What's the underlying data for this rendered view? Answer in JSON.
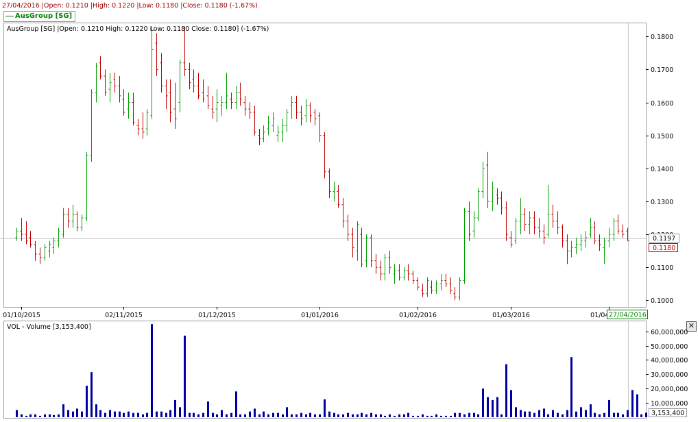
{
  "header": {
    "info_line": "27/04/2016 |Open: 0.1210 |High: 0.1220 |Low: 0.1180 |Close: 0.1180 (-1.67%)"
  },
  "legend": {
    "label": "AusGroup [SG]"
  },
  "price_panel": {
    "title": "AusGroup [SG] |Open: 0.1210  High: 0.1220  Low: 0.1180  Close: 0.1180] (-1.67%)",
    "crosshair_label": "0.1197",
    "last_price_label": "0.1180"
  },
  "volume_panel": {
    "title": "VOL - Volume [3,153,400]",
    "last_volume_label": "3,153,400"
  },
  "x_axis": {
    "ticks": [
      {
        "label": "01/10/2015",
        "i": 1
      },
      {
        "label": "02/11/2015",
        "i": 23
      },
      {
        "label": "01/12/2015",
        "i": 43
      },
      {
        "label": "01/01/2016",
        "i": 65
      },
      {
        "label": "01/02/2016",
        "i": 86
      },
      {
        "label": "01/03/2016",
        "i": 106
      },
      {
        "label": "01/04/2016",
        "i": 127
      }
    ],
    "last_date_label": "27/04/2016"
  },
  "colors": {
    "up": "#00a000",
    "down": "#c00000",
    "volume": "#0000a0",
    "accent": "#990000"
  },
  "chart_data": [
    {
      "type": "ohlc",
      "title": "AusGroup [SG]",
      "y_ticks": [
        0.1,
        0.11,
        0.12,
        0.13,
        0.14,
        0.15,
        0.16,
        0.17,
        0.18
      ],
      "ylim": [
        0.098,
        0.184
      ],
      "bars": [
        [
          0.119,
          0.122,
          0.118,
          0.121
        ],
        [
          0.121,
          0.125,
          0.118,
          0.12
        ],
        [
          0.12,
          0.124,
          0.117,
          0.118
        ],
        [
          0.119,
          0.121,
          0.116,
          0.117
        ],
        [
          0.117,
          0.118,
          0.112,
          0.114
        ],
        [
          0.114,
          0.116,
          0.111,
          0.113
        ],
        [
          0.113,
          0.117,
          0.112,
          0.116
        ],
        [
          0.115,
          0.118,
          0.113,
          0.117
        ],
        [
          0.116,
          0.119,
          0.114,
          0.118
        ],
        [
          0.118,
          0.122,
          0.116,
          0.121
        ],
        [
          0.12,
          0.128,
          0.119,
          0.126
        ],
        [
          0.126,
          0.128,
          0.122,
          0.124
        ],
        [
          0.124,
          0.129,
          0.122,
          0.126
        ],
        [
          0.126,
          0.127,
          0.121,
          0.122
        ],
        [
          0.122,
          0.126,
          0.121,
          0.125
        ],
        [
          0.125,
          0.145,
          0.124,
          0.144
        ],
        [
          0.144,
          0.164,
          0.142,
          0.163
        ],
        [
          0.163,
          0.172,
          0.16,
          0.171
        ],
        [
          0.172,
          0.174,
          0.167,
          0.168
        ],
        [
          0.168,
          0.17,
          0.162,
          0.163
        ],
        [
          0.164,
          0.169,
          0.16,
          0.166
        ],
        [
          0.167,
          0.169,
          0.163,
          0.165
        ],
        [
          0.165,
          0.168,
          0.16,
          0.162
        ],
        [
          0.161,
          0.164,
          0.156,
          0.157
        ],
        [
          0.158,
          0.163,
          0.155,
          0.16
        ],
        [
          0.16,
          0.163,
          0.153,
          0.154
        ],
        [
          0.153,
          0.155,
          0.15,
          0.152
        ],
        [
          0.152,
          0.157,
          0.149,
          0.151
        ],
        [
          0.152,
          0.158,
          0.15,
          0.157
        ],
        [
          0.156,
          0.183,
          0.155,
          0.176
        ],
        [
          0.178,
          0.181,
          0.168,
          0.17
        ],
        [
          0.172,
          0.175,
          0.163,
          0.165
        ],
        [
          0.165,
          0.167,
          0.158,
          0.162
        ],
        [
          0.163,
          0.167,
          0.154,
          0.157
        ],
        [
          0.158,
          0.166,
          0.152,
          0.155
        ],
        [
          0.16,
          0.173,
          0.157,
          0.172
        ],
        [
          0.172,
          0.183,
          0.168,
          0.17
        ],
        [
          0.17,
          0.172,
          0.164,
          0.166
        ],
        [
          0.167,
          0.17,
          0.163,
          0.165
        ],
        [
          0.165,
          0.169,
          0.161,
          0.162
        ],
        [
          0.163,
          0.167,
          0.16,
          0.161
        ],
        [
          0.162,
          0.165,
          0.158,
          0.159
        ],
        [
          0.158,
          0.162,
          0.155,
          0.157
        ],
        [
          0.158,
          0.164,
          0.154,
          0.16
        ],
        [
          0.159,
          0.162,
          0.156,
          0.16
        ],
        [
          0.16,
          0.169,
          0.158,
          0.162
        ],
        [
          0.161,
          0.163,
          0.158,
          0.16
        ],
        [
          0.16,
          0.165,
          0.158,
          0.163
        ],
        [
          0.163,
          0.166,
          0.159,
          0.161
        ],
        [
          0.16,
          0.162,
          0.156,
          0.158
        ],
        [
          0.158,
          0.16,
          0.155,
          0.157
        ],
        [
          0.157,
          0.159,
          0.15,
          0.151
        ],
        [
          0.15,
          0.152,
          0.147,
          0.149
        ],
        [
          0.149,
          0.153,
          0.148,
          0.151
        ],
        [
          0.152,
          0.156,
          0.15,
          0.154
        ],
        [
          0.153,
          0.157,
          0.151,
          0.155
        ],
        [
          0.15,
          0.153,
          0.148,
          0.151
        ],
        [
          0.151,
          0.155,
          0.148,
          0.153
        ],
        [
          0.153,
          0.158,
          0.151,
          0.157
        ],
        [
          0.159,
          0.162,
          0.155,
          0.16
        ],
        [
          0.16,
          0.162,
          0.155,
          0.157
        ],
        [
          0.157,
          0.159,
          0.153,
          0.155
        ],
        [
          0.156,
          0.161,
          0.154,
          0.159
        ],
        [
          0.159,
          0.16,
          0.154,
          0.156
        ],
        [
          0.157,
          0.158,
          0.153,
          0.155
        ],
        [
          0.156,
          0.157,
          0.148,
          0.15
        ],
        [
          0.15,
          0.151,
          0.137,
          0.139
        ],
        [
          0.139,
          0.14,
          0.131,
          0.133
        ],
        [
          0.133,
          0.136,
          0.13,
          0.134
        ],
        [
          0.133,
          0.135,
          0.128,
          0.129
        ],
        [
          0.129,
          0.131,
          0.122,
          0.124
        ],
        [
          0.124,
          0.126,
          0.118,
          0.12
        ],
        [
          0.12,
          0.122,
          0.113,
          0.116
        ],
        [
          0.115,
          0.124,
          0.112,
          0.123
        ],
        [
          0.12,
          0.122,
          0.11,
          0.111
        ],
        [
          0.112,
          0.12,
          0.11,
          0.119
        ],
        [
          0.119,
          0.12,
          0.11,
          0.112
        ],
        [
          0.112,
          0.114,
          0.108,
          0.11
        ],
        [
          0.11,
          0.112,
          0.106,
          0.108
        ],
        [
          0.108,
          0.114,
          0.106,
          0.113
        ],
        [
          0.113,
          0.115,
          0.108,
          0.11
        ],
        [
          0.108,
          0.111,
          0.105,
          0.109
        ],
        [
          0.109,
          0.111,
          0.106,
          0.107
        ],
        [
          0.107,
          0.11,
          0.106,
          0.109
        ],
        [
          0.109,
          0.111,
          0.106,
          0.108
        ],
        [
          0.108,
          0.109,
          0.105,
          0.106
        ],
        [
          0.106,
          0.107,
          0.103,
          0.104
        ],
        [
          0.103,
          0.105,
          0.101,
          0.102
        ],
        [
          0.102,
          0.107,
          0.101,
          0.106
        ],
        [
          0.104,
          0.106,
          0.102,
          0.103
        ],
        [
          0.103,
          0.106,
          0.102,
          0.105
        ],
        [
          0.105,
          0.108,
          0.103,
          0.106
        ],
        [
          0.106,
          0.108,
          0.104,
          0.105
        ],
        [
          0.105,
          0.107,
          0.102,
          0.103
        ],
        [
          0.102,
          0.104,
          0.1,
          0.101
        ],
        [
          0.101,
          0.107,
          0.1,
          0.106
        ],
        [
          0.106,
          0.128,
          0.105,
          0.127
        ],
        [
          0.127,
          0.13,
          0.118,
          0.12
        ],
        [
          0.121,
          0.127,
          0.119,
          0.125
        ],
        [
          0.125,
          0.134,
          0.124,
          0.133
        ],
        [
          0.133,
          0.142,
          0.131,
          0.14
        ],
        [
          0.141,
          0.145,
          0.128,
          0.13
        ],
        [
          0.13,
          0.136,
          0.127,
          0.134
        ],
        [
          0.132,
          0.134,
          0.129,
          0.131
        ],
        [
          0.131,
          0.133,
          0.126,
          0.128
        ],
        [
          0.128,
          0.13,
          0.118,
          0.12
        ],
        [
          0.119,
          0.121,
          0.116,
          0.117
        ],
        [
          0.118,
          0.125,
          0.117,
          0.124
        ],
        [
          0.124,
          0.131,
          0.12,
          0.126
        ],
        [
          0.126,
          0.128,
          0.121,
          0.123
        ],
        [
          0.123,
          0.127,
          0.12,
          0.125
        ],
        [
          0.125,
          0.127,
          0.12,
          0.122
        ],
        [
          0.122,
          0.125,
          0.119,
          0.121
        ],
        [
          0.121,
          0.123,
          0.117,
          0.119
        ],
        [
          0.12,
          0.135,
          0.119,
          0.126
        ],
        [
          0.126,
          0.129,
          0.122,
          0.124
        ],
        [
          0.124,
          0.127,
          0.12,
          0.122
        ],
        [
          0.122,
          0.123,
          0.116,
          0.118
        ],
        [
          0.118,
          0.12,
          0.111,
          0.115
        ],
        [
          0.115,
          0.118,
          0.113,
          0.116
        ],
        [
          0.116,
          0.119,
          0.114,
          0.117
        ],
        [
          0.117,
          0.12,
          0.115,
          0.118
        ],
        [
          0.118,
          0.121,
          0.116,
          0.119
        ],
        [
          0.12,
          0.125,
          0.119,
          0.122
        ],
        [
          0.122,
          0.124,
          0.117,
          0.118
        ],
        [
          0.118,
          0.12,
          0.115,
          0.117
        ],
        [
          0.116,
          0.119,
          0.111,
          0.118
        ],
        [
          0.118,
          0.122,
          0.116,
          0.12
        ],
        [
          0.12,
          0.125,
          0.118,
          0.124
        ],
        [
          0.124,
          0.126,
          0.12,
          0.121
        ],
        [
          0.121,
          0.123,
          0.119,
          0.12
        ],
        [
          0.121,
          0.122,
          0.118,
          0.118
        ]
      ]
    },
    {
      "type": "bar",
      "title": "VOL - Volume",
      "y_ticks": [
        10000000,
        20000000,
        30000000,
        40000000,
        50000000,
        60000000
      ],
      "y_tick_labels": [
        "10,000,000",
        "20,000,000",
        "30,000,000",
        "40,000,000",
        "50,000,000",
        "60,000,000"
      ],
      "ylim": [
        0,
        67000000
      ],
      "values": [
        5000000,
        2000000,
        1000000,
        2000000,
        2000000,
        1000000,
        2000000,
        2000000,
        1500000,
        2000000,
        9000000,
        5000000,
        4000000,
        6000000,
        4000000,
        22000000,
        31500000,
        9000000,
        5000000,
        3000000,
        5000000,
        4000000,
        4000000,
        3000000,
        4000000,
        3000000,
        3000000,
        2000000,
        3000000,
        65000000,
        4000000,
        4000000,
        3000000,
        5000000,
        12000000,
        7000000,
        57000000,
        3000000,
        3000000,
        2000000,
        3000000,
        11000000,
        3000000,
        2000000,
        5000000,
        2000000,
        3000000,
        18000000,
        2000000,
        2000000,
        4000000,
        6000000,
        2000000,
        4000000,
        2000000,
        3000000,
        3000000,
        2000000,
        7000000,
        2000000,
        2000000,
        3000000,
        2000000,
        3000000,
        2000000,
        2000000,
        12500000,
        4000000,
        3000000,
        2000000,
        2000000,
        3000000,
        2000000,
        2000000,
        3000000,
        2000000,
        3000000,
        2000000,
        2000000,
        1000000,
        2000000,
        1000000,
        2000000,
        2000000,
        3000000,
        1000000,
        1000000,
        2000000,
        1000000,
        1000000,
        2000000,
        1000000,
        1000000,
        1000000,
        3000000,
        3000000,
        2000000,
        3000000,
        3000000,
        2000000,
        20000000,
        14000000,
        12000000,
        14000000,
        2000000,
        37000000,
        19000000,
        7000000,
        5000000,
        4000000,
        4000000,
        3000000,
        5000000,
        6000000,
        2000000,
        5000000,
        3000000,
        2000000,
        5000000,
        42000000,
        4000000,
        7000000,
        5000000,
        9000000,
        3000000,
        2000000,
        3000000,
        12000000,
        3000000,
        3000000,
        2000000,
        5000000,
        19000000,
        16000000,
        2000000,
        3153400
      ]
    }
  ]
}
